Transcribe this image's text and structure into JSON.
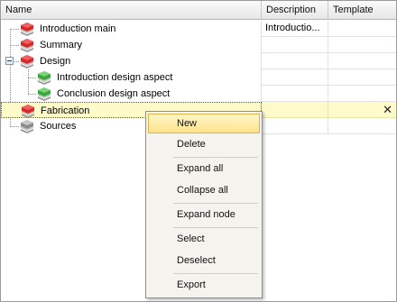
{
  "columns": {
    "name": "Name",
    "description": "Description",
    "template": "Template"
  },
  "rows": [
    {
      "name": "Introduction main",
      "description": "Introductio...",
      "icon": "red-book-icon"
    },
    {
      "name": "Summary",
      "description": "",
      "icon": "red-book-icon"
    },
    {
      "name": "Design",
      "description": "",
      "icon": "red-book-icon",
      "expanded": true
    },
    {
      "name": "Introduction design aspect",
      "description": "",
      "icon": "green-book-icon"
    },
    {
      "name": "Conclusion design aspect",
      "description": "",
      "icon": "green-book-icon"
    },
    {
      "name": "Fabrication",
      "description": "",
      "icon": "red-book-icon",
      "selected": true,
      "close_glyph": "✕"
    },
    {
      "name": "Sources",
      "description": "",
      "icon": "gray-book-icon"
    }
  ],
  "context_menu": {
    "items": [
      "New",
      "Delete",
      "Expand all",
      "Collapse all",
      "Expand node",
      "Select",
      "Deselect",
      "Export"
    ],
    "highlighted": "New"
  },
  "colors": {
    "selected_row": "#fffbc8",
    "menu_highlight": "#ffe38a",
    "book_red": "#d42a2a",
    "book_green": "#3aa63a"
  }
}
